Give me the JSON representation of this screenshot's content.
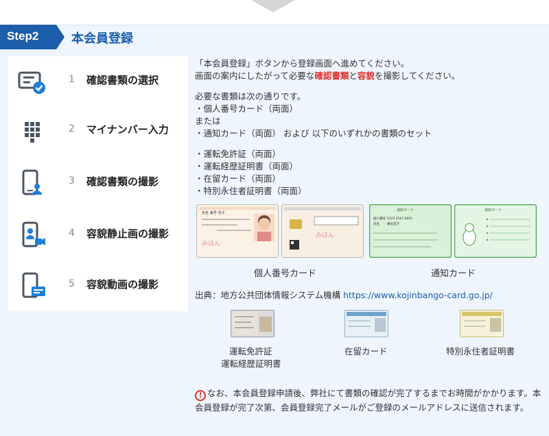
{
  "header": {
    "step_badge": "Step2",
    "title": "本会員登録"
  },
  "steps": [
    {
      "num": "1",
      "label": "確認書類の選択",
      "icon": "document-check-icon"
    },
    {
      "num": "2",
      "label": "マイナンバー入力",
      "icon": "keypad-icon"
    },
    {
      "num": "3",
      "label": "確認書類の撮影",
      "icon": "phone-person-icon"
    },
    {
      "num": "4",
      "label": "容貌静止画の撮影",
      "icon": "phone-video-icon"
    },
    {
      "num": "5",
      "label": "容貌動画の撮影",
      "icon": "phone-card-icon"
    }
  ],
  "intro": {
    "line1": "「本会員登録」ボタンから登録画面へ進めてください。",
    "line2_a": "画面の案内にしたがって必要な",
    "line2_red1": "確認書類",
    "line2_b": "と",
    "line2_red2": "容貌",
    "line2_c": "を撮影してください。"
  },
  "required": {
    "heading": "必要な書類は次の通りです。",
    "item1": "・個人番号カード（両面）",
    "or": "または",
    "item2": "・通知カード（両面） および 以下のいずれかの書類のセット",
    "sub1": "・運転免許証（両面）",
    "sub2": "・運転経歴証明書（両面）",
    "sub3": "・在留カード（両面）",
    "sub4": "・特別永住者証明書（両面）"
  },
  "cards": {
    "mynumber_caption": "個人番号カード",
    "notice_caption": "通知カード",
    "mynumber_name_label": "氏名",
    "mynumber_name": "番号 花子",
    "notice_title": "通知カード",
    "notice_number_label": "個人番号",
    "notice_number": "0123 4567 8901",
    "notice_name_label": "氏名",
    "notice_name": "番号花子"
  },
  "source": {
    "label": "出典：地方公共団体情報システム機構 ",
    "link": "https://www.kojinbango-card.go.jp/"
  },
  "other_docs": {
    "license_caption1": "運転免許証",
    "license_caption2": "運転経歴証明書",
    "residence_caption": "在留カード",
    "permanent_caption": "特別永住者証明書"
  },
  "note": {
    "text": "なお、本会員登録申請後、弊社にて書類の確認が完了するまでお時間がかかります。本会員登録が完了次第、会員登録完了メールがご登録のメールアドレスに送信されます。"
  },
  "colors": {
    "brand_blue": "#1d5eab",
    "accent_red": "#d9302a",
    "panel_bg": "#eef5fc"
  }
}
